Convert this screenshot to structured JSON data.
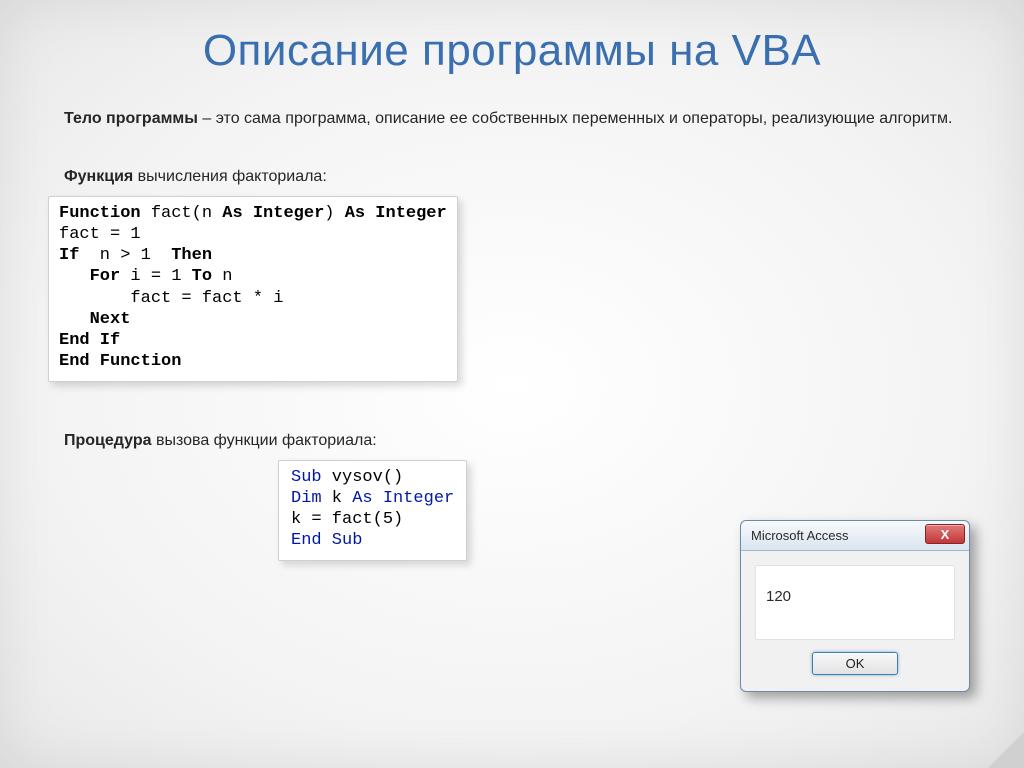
{
  "title": "Описание программы на VBA",
  "intro_bold": "Тело программы",
  "intro_rest": " – это сама программа, описание ее собственных переменных и операторы, реализующие алгоритм.",
  "sub1_bold": "Функция",
  "sub1_rest": " вычисления факториала:",
  "code1": {
    "l1a": "Function",
    "l1b": " fact(n ",
    "l1c": "As Integer",
    "l1d": ") ",
    "l1e": "As Integer",
    "l2": "fact = 1",
    "l3a": "If",
    "l3b": "  n > 1  ",
    "l3c": "Then",
    "l4a": "   For",
    "l4b": " i = 1 ",
    "l4c": "To",
    "l4d": " n",
    "l5": "       fact = fact * i",
    "l6": "   Next",
    "l7a": "End",
    "l7b": " If",
    "l8": "End Function"
  },
  "sub2_bold": "Процедура",
  "sub2_rest": " вызова функции факториала:",
  "code2": {
    "l1a": "Sub",
    "l1b": " vysov()",
    "l2a": "Dim",
    "l2b": " k ",
    "l2c": "As",
    "l2d": " ",
    "l2e": "Integer",
    "l3": "k = fact(5)",
    "l4": "End Sub"
  },
  "dialog": {
    "title": "Microsoft Access",
    "value": "120",
    "ok": "OK",
    "close": "X"
  }
}
